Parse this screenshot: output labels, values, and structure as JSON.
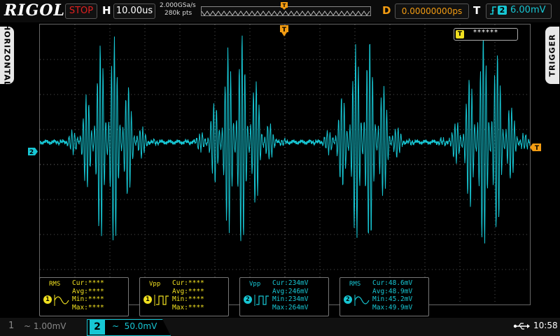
{
  "header": {
    "brand": "RIGOL",
    "run_state": "STOP",
    "horizontal_label": "H",
    "timebase": "10.00us",
    "sample_rate": "2.000GSa/s",
    "memory_depth": "280k pts",
    "delay_label": "D",
    "delay_value": "0.00000000ps",
    "trigger_label": "T",
    "trigger_channel": "2",
    "trigger_level": "6.00mV"
  },
  "side_tabs": {
    "left": "HORIZONTAL",
    "right": "TRIGGER"
  },
  "display": {
    "trigger_status_label": "T",
    "trigger_status_text": "******",
    "channel_marker": "2",
    "trigger_level_marker": "T",
    "trigger_position_marker": "T",
    "trace_color": "#17c7d4"
  },
  "measurements": [
    {
      "name": "RMS",
      "channel": "1",
      "channel_color": "#f0e020",
      "cur_label": "Cur:",
      "cur": "****",
      "avg_label": "Avg:",
      "avg": "****",
      "min_label": "Min:",
      "min": "****",
      "max_label": "Max:",
      "max": "****"
    },
    {
      "name": "Vpp",
      "channel": "1",
      "channel_color": "#f0e020",
      "cur_label": "Cur:",
      "cur": "****",
      "avg_label": "Avg:",
      "avg": "****",
      "min_label": "Min:",
      "min": "****",
      "max_label": "Max:",
      "max": "****"
    },
    {
      "name": "Vpp",
      "channel": "2",
      "channel_color": "#17c7d4",
      "cur_label": "Cur:",
      "cur": "234mV",
      "avg_label": "Avg:",
      "avg": "246mV",
      "min_label": "Min:",
      "min": "234mV",
      "max_label": "Max:",
      "max": "264mV"
    },
    {
      "name": "RMS",
      "channel": "2",
      "channel_color": "#17c7d4",
      "cur_label": "Cur:",
      "cur": "48.6mV",
      "avg_label": "Avg:",
      "avg": "48.9mV",
      "min_label": "Min:",
      "min": "45.2mV",
      "max_label": "Max:",
      "max": "49.9mV"
    }
  ],
  "footer": {
    "ch1_number": "1",
    "ch1_scale": "~ 1.00mV",
    "ch2_number": "2",
    "ch2_scale": "~  50.0mV",
    "clock": "10:58",
    "usb_icon": "usb-icon"
  }
}
